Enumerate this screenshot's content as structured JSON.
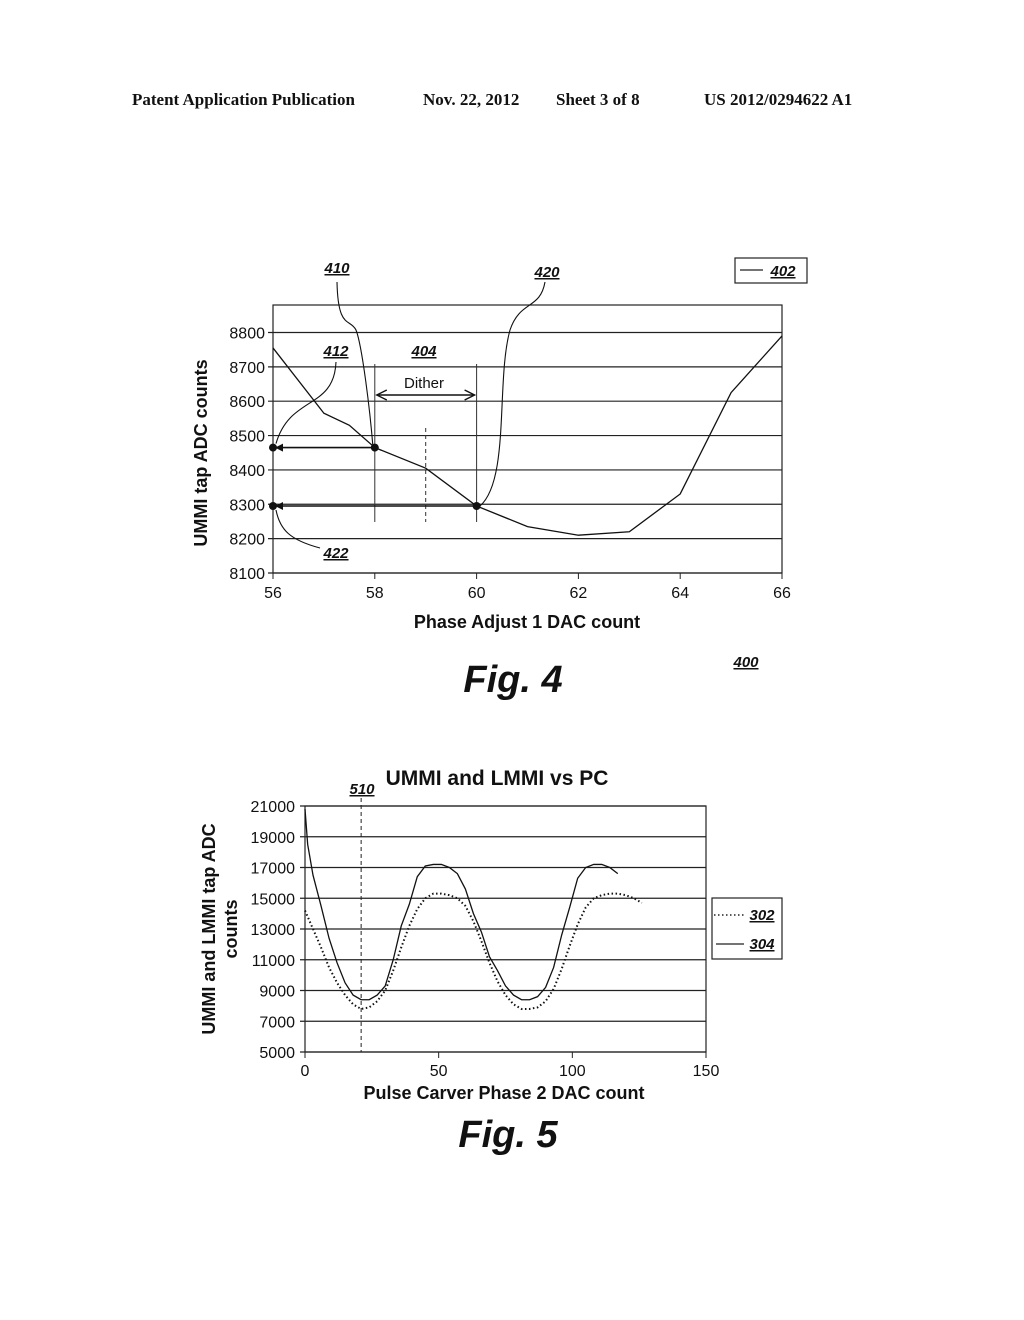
{
  "header": {
    "publication": "Patent Application Publication",
    "date": "Nov. 22, 2012",
    "sheet": "Sheet 3 of 8",
    "number": "US 2012/0294622 A1"
  },
  "fig4": {
    "label": "Fig. 4",
    "ref_figure": "400",
    "refs": {
      "r410": "410",
      "r412": "412",
      "r404": "404",
      "r420": "420",
      "r422": "422",
      "legend": "402"
    },
    "dither_label": "Dither"
  },
  "fig5": {
    "label": "Fig. 5",
    "ref_line": "510"
  },
  "chart_data": [
    {
      "type": "line",
      "title": "",
      "xlabel": "Phase Adjust 1 DAC count",
      "ylabel": "UMMI tap ADC counts",
      "xlim": [
        56,
        66
      ],
      "ylim": [
        8100,
        8880
      ],
      "xticks": [
        56,
        58,
        60,
        62,
        64,
        66
      ],
      "yticks": [
        8100,
        8200,
        8300,
        8400,
        8500,
        8600,
        8700,
        8800
      ],
      "grid": "horizontal",
      "legend": {
        "position": "top-right",
        "entries": [
          "402"
        ]
      },
      "series": [
        {
          "name": "402",
          "x": [
            56,
            57,
            57.5,
            58,
            59,
            60,
            61,
            62,
            63,
            64,
            65,
            66
          ],
          "y": [
            8755,
            8565,
            8530,
            8465,
            8405,
            8295,
            8235,
            8210,
            8220,
            8330,
            8625,
            8790
          ]
        }
      ],
      "annotations": {
        "dither_range": [
          58,
          60
        ],
        "dither_center": 59,
        "point_410": {
          "x": 58,
          "y": 8465
        },
        "point_420": {
          "x": 60,
          "y": 8295
        },
        "point_412": {
          "x": 56,
          "y": 8465
        },
        "point_422": {
          "x": 56,
          "y": 8295
        }
      }
    },
    {
      "type": "line",
      "title": "UMMI and LMMI vs PC",
      "xlabel": "Pulse Carver Phase 2 DAC count",
      "ylabel": "UMMI and LMMI tap ADC counts",
      "xlim": [
        0,
        150
      ],
      "ylim": [
        5000,
        21000
      ],
      "xticks": [
        0,
        50,
        100,
        150
      ],
      "yticks": [
        5000,
        7000,
        9000,
        11000,
        13000,
        15000,
        17000,
        19000,
        21000
      ],
      "grid": "horizontal",
      "legend": {
        "position": "right",
        "entries": [
          "302",
          "304"
        ]
      },
      "vline_510": 21,
      "series": [
        {
          "name": "302",
          "style": "dotted",
          "x": [
            0,
            3,
            6,
            9,
            12,
            15,
            18,
            21,
            24,
            27,
            30,
            33,
            36,
            39,
            42,
            45,
            48,
            51,
            54,
            57,
            60,
            63,
            66,
            69,
            72,
            75,
            78,
            81,
            84,
            87,
            90,
            93,
            96,
            99,
            102,
            105,
            108,
            111,
            114,
            117,
            120,
            123,
            126
          ],
          "y": [
            14200,
            13000,
            11800,
            10500,
            9500,
            8700,
            8100,
            7800,
            7900,
            8300,
            9000,
            10300,
            11800,
            13200,
            14300,
            15000,
            15300,
            15300,
            15200,
            15000,
            14500,
            13500,
            12200,
            10800,
            9600,
            8700,
            8100,
            7800,
            7800,
            7900,
            8300,
            9100,
            10400,
            11900,
            13300,
            14400,
            15000,
            15200,
            15300,
            15300,
            15200,
            15000,
            14700
          ]
        },
        {
          "name": "304",
          "style": "solid",
          "x": [
            0,
            1,
            3,
            6,
            9,
            12,
            15,
            18,
            21,
            24,
            27,
            30,
            33,
            36,
            39,
            42,
            45,
            48,
            51,
            54,
            57,
            60,
            63,
            66,
            69,
            72,
            75,
            78,
            81,
            84,
            87,
            90,
            93,
            96,
            99,
            102,
            105,
            108,
            111,
            114,
            117,
            120,
            123,
            126
          ],
          "y": [
            20800,
            18500,
            16500,
            14500,
            12400,
            10800,
            9500,
            8700,
            8400,
            8400,
            8700,
            9300,
            11000,
            13200,
            14600,
            16400,
            17100,
            17200,
            17200,
            17000,
            16600,
            15600,
            14000,
            12800,
            11200,
            10300,
            9300,
            8700,
            8400,
            8400,
            8600,
            9200,
            10500,
            12600,
            14400,
            16300,
            17000,
            17200,
            17200,
            17000,
            16600
          ]
        }
      ]
    }
  ]
}
